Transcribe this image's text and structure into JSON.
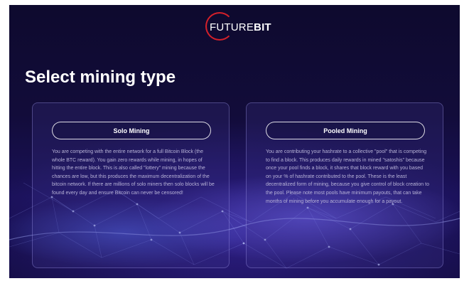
{
  "brand": {
    "logo_light": "FUTURE",
    "logo_bold": "BIT",
    "accent_color": "#d4202a"
  },
  "page_title": "Select mining type",
  "options": [
    {
      "label": "Solo Mining",
      "description": "You are competing with the entire network for a full Bitcoin Block (the whole BTC reward). You gain zero rewards while mining, in hopes of hitting the entire block. This is also called \"lottery\" mining because the chances are low, but this produces the maximum decentralization of the bitcoin network. If there are millions of solo miners then solo blocks will be found every day and ensure Bitcoin can never be censored!"
    },
    {
      "label": "Pooled Mining",
      "description": "You are contributing your hashrate to a collective \"pool\" that is competing to find a block. This produces daily rewards in mined \"satoshis\" because once your pool finds a block, it shares that block reward with you based on your % of hashrate contributed to the pool. These is the least decentralized form of mining, because you give control of block creation to the pool. Please note most pools have minimum payouts, that can take months of mining before you accumulate enough for a payout."
    }
  ]
}
